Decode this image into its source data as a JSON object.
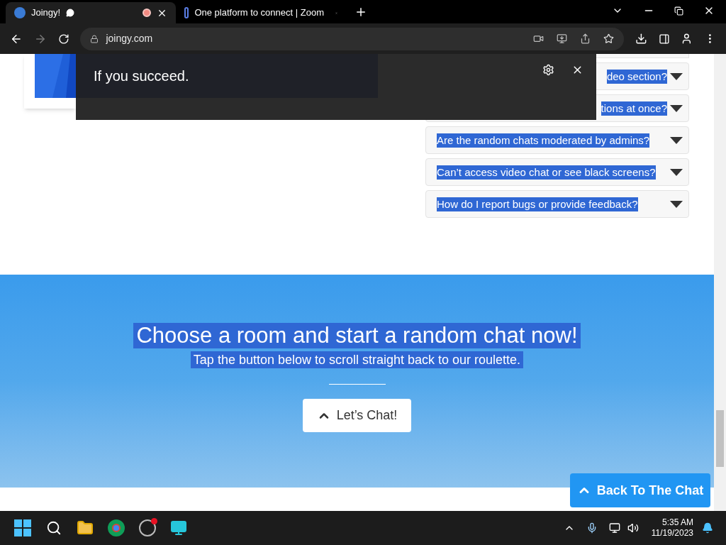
{
  "browser": {
    "tabs": [
      {
        "title": "Joingy!",
        "selected": true,
        "recording": true,
        "chat_badge": true
      },
      {
        "title": "One platform to connect | Zoom",
        "selected": false,
        "recording": false,
        "chat_badge": false
      }
    ],
    "address": "joingy.com"
  },
  "caption_overlay": {
    "text": "If you succeed."
  },
  "faq": [
    {
      "question": "deo section?",
      "highlighted": true,
      "partly_covered": true
    },
    {
      "question": "tions at once?",
      "highlighted": true,
      "partly_covered": true
    },
    {
      "question": "Are the random chats moderated by admins?",
      "highlighted": true,
      "partly_covered": false
    },
    {
      "question": "Can’t access video chat or see black screens?",
      "highlighted": true,
      "partly_covered": false
    },
    {
      "question": "How do I report bugs or provide feedback?",
      "highlighted": true,
      "partly_covered": false
    }
  ],
  "cta": {
    "title": "Choose a room and start a random chat now!",
    "subtitle": "Tap the button below to scroll straight back to our roulette.",
    "highlighted": true,
    "button": "Let’s Chat!"
  },
  "back_button": "Back To The Chat",
  "taskbar": {
    "time": "5:35 AM",
    "date": "11/19/2023"
  }
}
